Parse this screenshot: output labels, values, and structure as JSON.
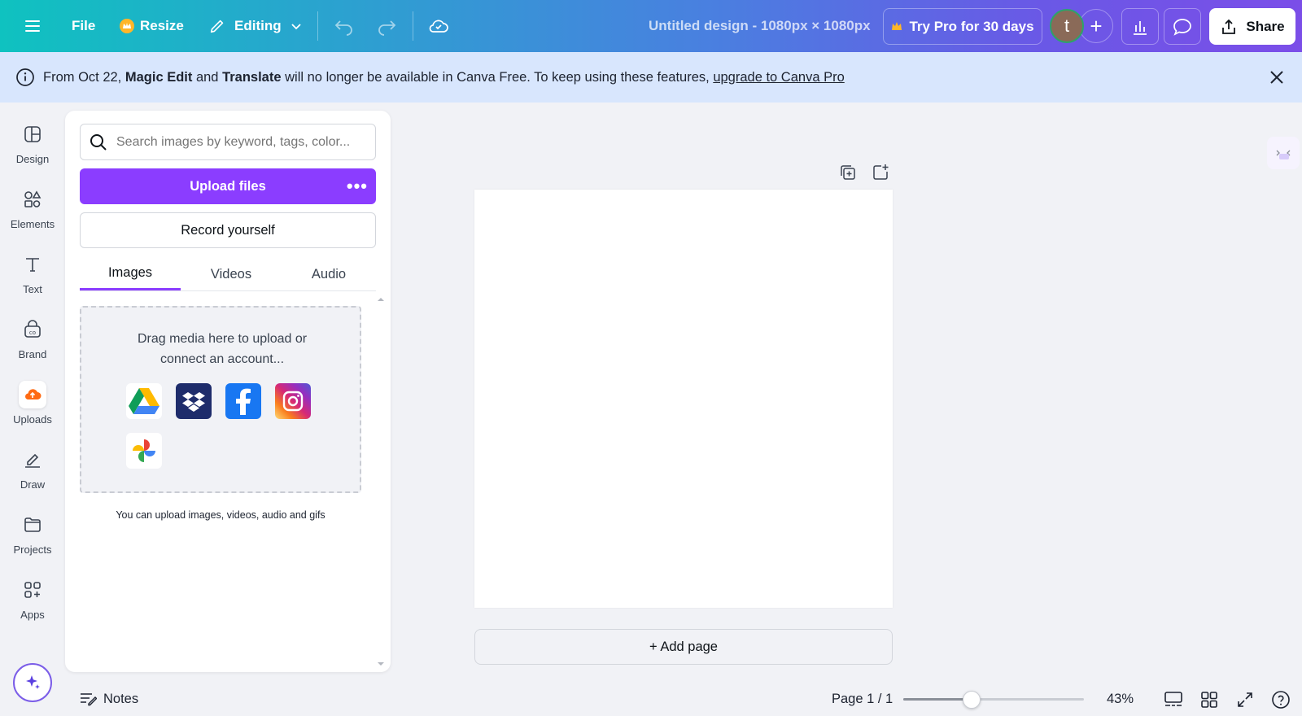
{
  "topbar": {
    "file_label": "File",
    "resize_label": "Resize",
    "editing_label": "Editing",
    "design_title": "Untitled design - 1080px × 1080px",
    "try_pro_label": "Try Pro for 30 days",
    "avatar_initial": "t",
    "share_label": "Share"
  },
  "banner": {
    "prefix": "From Oct 22, ",
    "feature1": "Magic Edit",
    "and": " and ",
    "feature2": "Translate",
    "middle": " will no longer be available in Canva Free. To keep using these features, ",
    "link": "upgrade to Canva Pro"
  },
  "rail": {
    "items": [
      {
        "label": "Design",
        "icon": "layout-icon"
      },
      {
        "label": "Elements",
        "icon": "shapes-icon"
      },
      {
        "label": "Text",
        "icon": "text-icon"
      },
      {
        "label": "Brand",
        "icon": "brand-icon"
      },
      {
        "label": "Uploads",
        "icon": "cloud-upload-icon"
      },
      {
        "label": "Draw",
        "icon": "pen-icon"
      },
      {
        "label": "Projects",
        "icon": "folder-icon"
      },
      {
        "label": "Apps",
        "icon": "apps-icon"
      }
    ],
    "active": "Uploads"
  },
  "uploads": {
    "search_placeholder": "Search images by keyword, tags, color...",
    "upload_label": "Upload files",
    "more_label": "•••",
    "record_label": "Record yourself",
    "tabs": [
      "Images",
      "Videos",
      "Audio"
    ],
    "active_tab": "Images",
    "dropzone_text_1": "Drag media here to upload or",
    "dropzone_text_2": "connect an account...",
    "services": [
      "Google Drive",
      "Dropbox",
      "Facebook",
      "Instagram",
      "Google Photos"
    ],
    "hint": "You can upload images, videos, audio and gifs"
  },
  "canvas": {
    "add_page_label": "+ Add page"
  },
  "footer": {
    "notes_label": "Notes",
    "page_label": "Page 1 / 1",
    "zoom_label": "43%",
    "zoom_level": 0.38
  },
  "colors": {
    "accent": "#8b3dff",
    "banner_bg": "#d8e6fd"
  }
}
